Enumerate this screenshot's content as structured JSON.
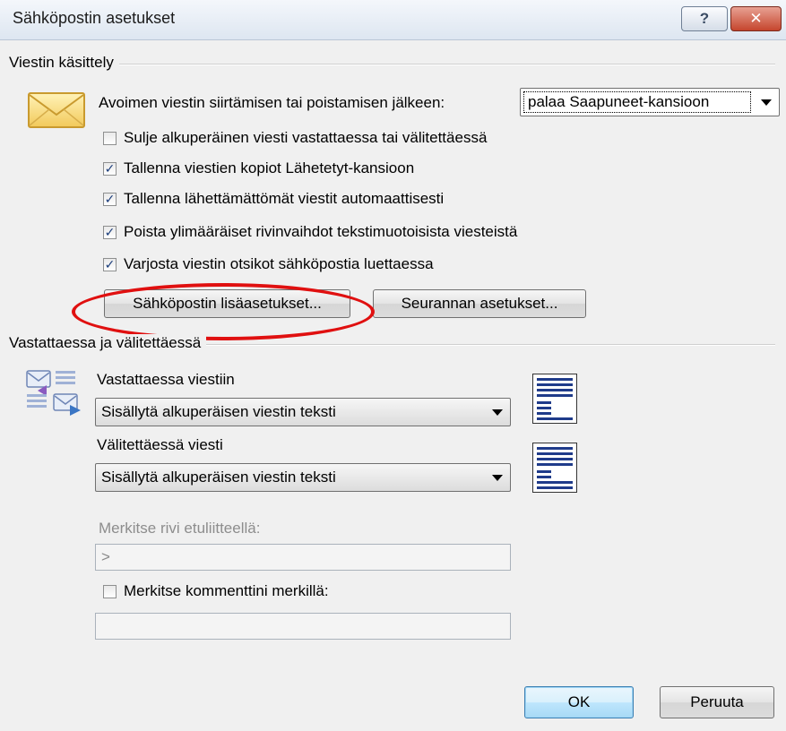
{
  "window": {
    "title": "Sähköpostin asetukset",
    "help_label": "?",
    "close_label": "✕"
  },
  "message_handling": {
    "group_label": "Viestin käsittely",
    "icon": "envelope-icon",
    "after_move_label": "Avoimen viestin siirtämisen tai poistamisen jälkeen:",
    "after_move_value": "palaa Saapuneet-kansioon",
    "checkboxes": [
      {
        "label": "Sulje alkuperäinen viesti vastattaessa tai välitettäessä",
        "checked": false
      },
      {
        "label": "Tallenna viestien kopiot Lähetetyt-kansioon",
        "checked": true
      },
      {
        "label": "Tallenna lähettämättömät viestit automaattisesti",
        "checked": true
      },
      {
        "label": "Poista ylimääräiset rivinvaihdot tekstimuotoisista viesteistä",
        "checked": true
      },
      {
        "label": "Varjosta viestin otsikot sähköpostia luettaessa",
        "checked": true
      }
    ],
    "advanced_button": "Sähköpostin lisäasetukset...",
    "tracking_button": "Seurannan asetukset..."
  },
  "reply_forward": {
    "group_label": "Vastattaessa ja välitettäessä",
    "icon": "reply-forward-icon",
    "reply_label": "Vastattaessa viestiin",
    "reply_value": "Sisällytä alkuperäisen viestin teksti",
    "forward_label": "Välitettäessä viesti",
    "forward_value": "Sisällytä alkuperäisen viestin teksti",
    "prefix_label": "Merkitse rivi etuliitteellä:",
    "prefix_value": ">",
    "comments_label": "Merkitse kommenttini merkillä:",
    "comments_checked": false,
    "comments_value": ""
  },
  "footer": {
    "ok_label": "OK",
    "cancel_label": "Peruuta"
  },
  "colors": {
    "highlight_ellipse": "#e01010",
    "close_button": "#c5452d"
  }
}
